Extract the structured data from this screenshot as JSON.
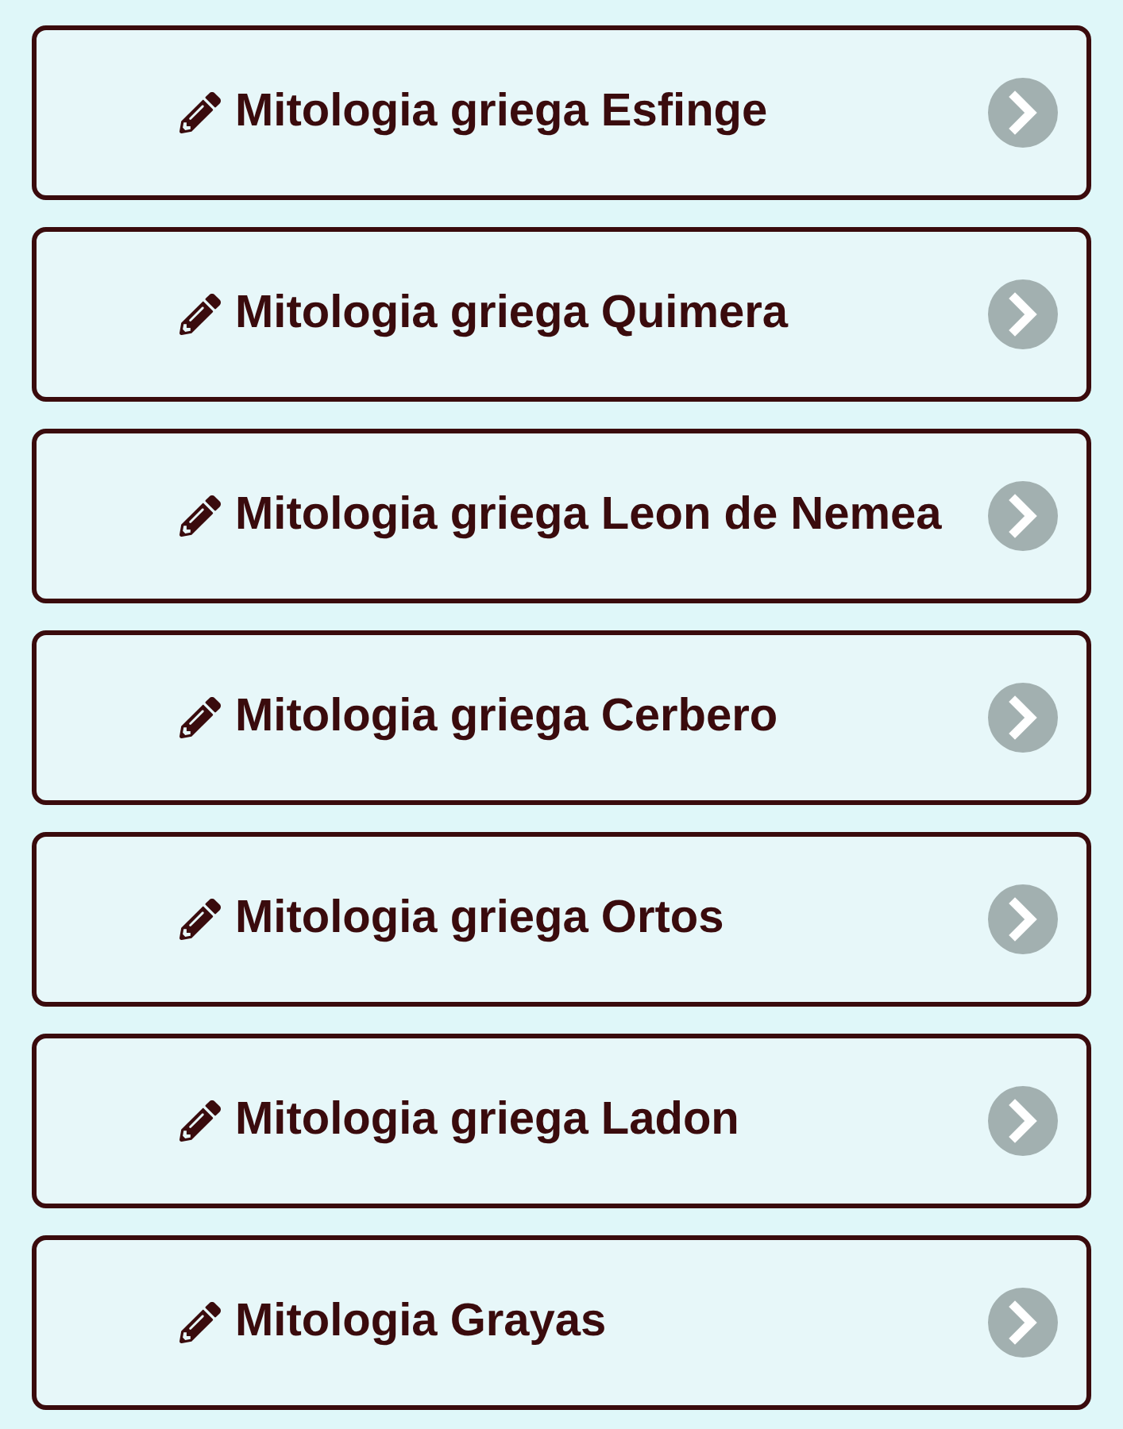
{
  "items": [
    {
      "label": "Mitologia griega Esfinge"
    },
    {
      "label": "Mitologia griega Quimera"
    },
    {
      "label": "Mitologia griega Leon de Nemea"
    },
    {
      "label": "Mitologia griega Cerbero"
    },
    {
      "label": "Mitologia griega Ortos"
    },
    {
      "label": "Mitologia griega Ladon"
    },
    {
      "label": "Mitologia Grayas"
    }
  ]
}
